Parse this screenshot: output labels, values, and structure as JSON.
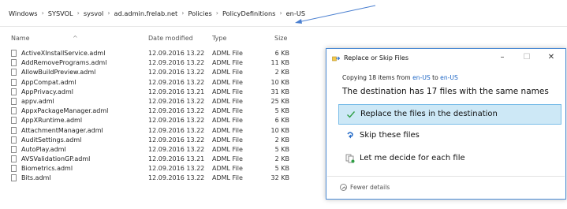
{
  "breadcrumb": [
    "Windows",
    "SYSVOL",
    "sysvol",
    "ad.admin.frelab.net",
    "Policies",
    "PolicyDefinitions",
    "en-US"
  ],
  "columns": {
    "name": "Name",
    "date": "Date modified",
    "type": "Type",
    "size": "Size"
  },
  "files": [
    {
      "name": "ActiveXInstallService.adml",
      "date": "12.09.2016 13.22",
      "type": "ADML File",
      "size": "6 KB"
    },
    {
      "name": "AddRemovePrograms.adml",
      "date": "12.09.2016 13.22",
      "type": "ADML File",
      "size": "11 KB"
    },
    {
      "name": "AllowBuildPreview.adml",
      "date": "12.09.2016 13.22",
      "type": "ADML File",
      "size": "2 KB"
    },
    {
      "name": "AppCompat.adml",
      "date": "12.09.2016 13.22",
      "type": "ADML File",
      "size": "10 KB"
    },
    {
      "name": "AppPrivacy.adml",
      "date": "12.09.2016 13.21",
      "type": "ADML File",
      "size": "31 KB"
    },
    {
      "name": "appv.adml",
      "date": "12.09.2016 13.22",
      "type": "ADML File",
      "size": "25 KB"
    },
    {
      "name": "AppxPackageManager.adml",
      "date": "12.09.2016 13.22",
      "type": "ADML File",
      "size": "5 KB"
    },
    {
      "name": "AppXRuntime.adml",
      "date": "12.09.2016 13.22",
      "type": "ADML File",
      "size": "6 KB"
    },
    {
      "name": "AttachmentManager.adml",
      "date": "12.09.2016 13.22",
      "type": "ADML File",
      "size": "10 KB"
    },
    {
      "name": "AuditSettings.adml",
      "date": "12.09.2016 13.22",
      "type": "ADML File",
      "size": "2 KB"
    },
    {
      "name": "AutoPlay.adml",
      "date": "12.09.2016 13.22",
      "type": "ADML File",
      "size": "5 KB"
    },
    {
      "name": "AVSValidationGP.adml",
      "date": "12.09.2016 13.21",
      "type": "ADML File",
      "size": "2 KB"
    },
    {
      "name": "Biometrics.adml",
      "date": "12.09.2016 13.22",
      "type": "ADML File",
      "size": "5 KB"
    },
    {
      "name": "Bits.adml",
      "date": "12.09.2016 13.22",
      "type": "ADML File",
      "size": "32 KB"
    }
  ],
  "dialog": {
    "title": "Replace or Skip Files",
    "copying_prefix": "Copying 18 items from ",
    "source": "en-US",
    "to_word": " to ",
    "destination": "en-US",
    "message": "The destination has 17 files with the same names",
    "options": {
      "replace": "Replace the files in the destination",
      "skip": "Skip these files",
      "decide": "Let me decide for each file"
    },
    "fewer_details": "Fewer details",
    "minimize": "–",
    "maximize": "☐",
    "close": "✕"
  },
  "colors": {
    "accent": "#1a64c4",
    "selected_option_bg": "#cde8f6",
    "dialog_border": "#4b8bd4",
    "check": "#2f9e44"
  }
}
